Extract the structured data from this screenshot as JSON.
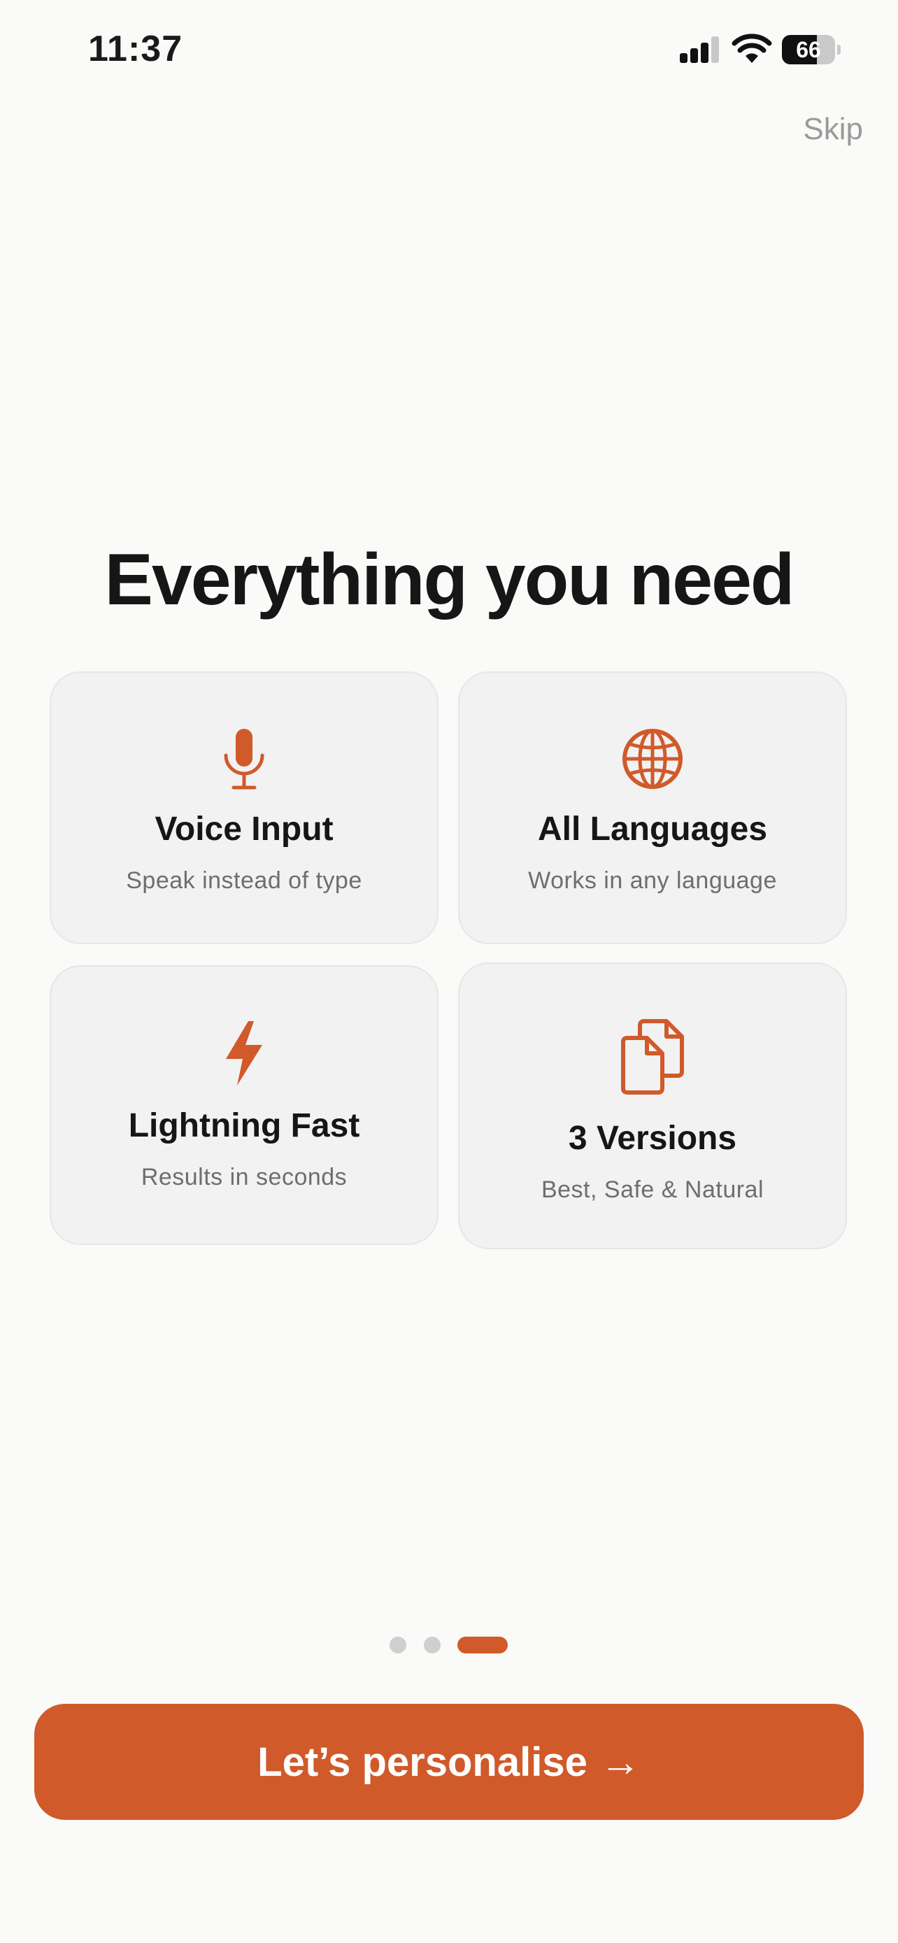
{
  "status_bar": {
    "time": "11:37",
    "battery_level": "66",
    "battery_fraction": 0.66
  },
  "header": {
    "skip_label": "Skip"
  },
  "main": {
    "headline": "Everything you need",
    "features": [
      {
        "icon": "microphone-icon",
        "title": "Voice Input",
        "subtitle": "Speak instead of type"
      },
      {
        "icon": "globe-icon",
        "title": "All Languages",
        "subtitle": "Works in any language"
      },
      {
        "icon": "lightning-bolt-icon",
        "title": "Lightning Fast",
        "subtitle": "Results in seconds"
      },
      {
        "icon": "documents-icon",
        "title": "3 Versions",
        "subtitle": "Best, Safe & Natural"
      }
    ]
  },
  "pagination": {
    "page_count": 3,
    "current_page": 3
  },
  "footer": {
    "cta_label": "Let’s personalise",
    "cta_arrow": "→"
  },
  "colors": {
    "accent": "#d05a2a",
    "background": "#fafaf8",
    "card": "#f2f2f2",
    "text": "#161616",
    "muted_text": "#6e6e6e"
  }
}
